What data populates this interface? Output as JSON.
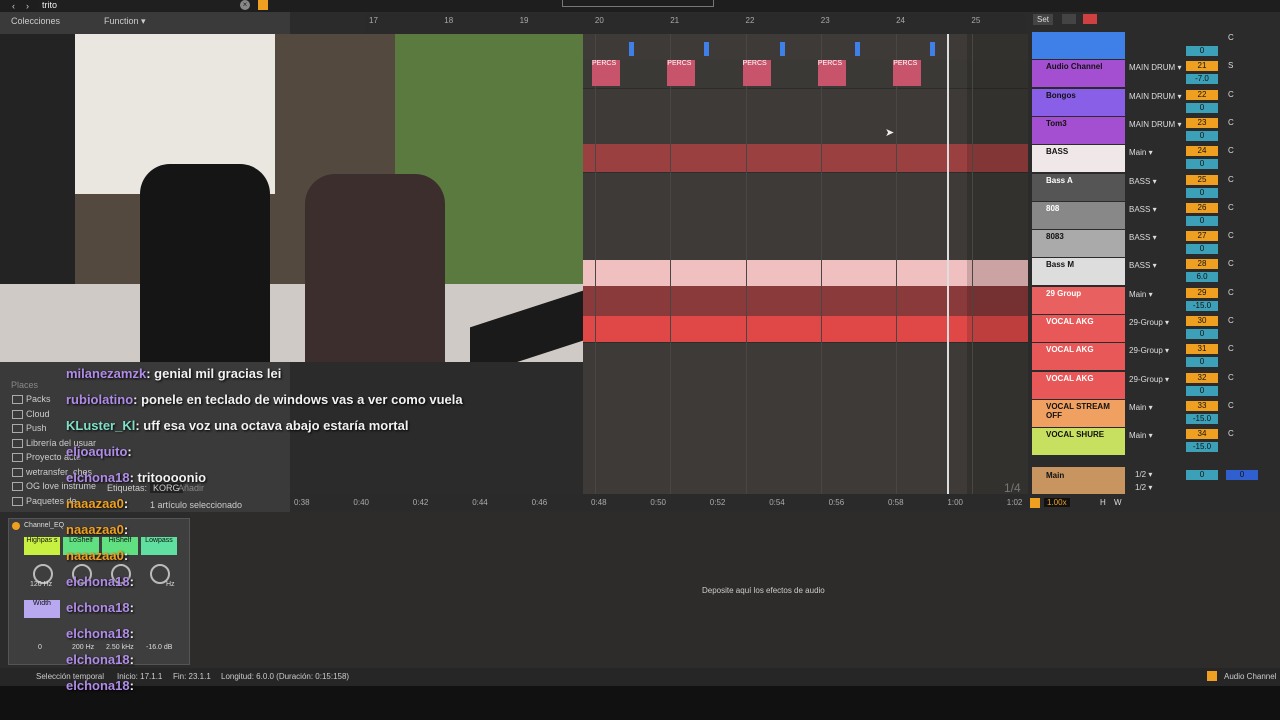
{
  "browser": {
    "search_value": "trito",
    "collections_label": "Colecciones",
    "function_label": "Function ▾",
    "places_label": "Places",
    "places": [
      "Packs",
      "Cloud",
      "Push",
      "Librería del usuar",
      "Proyecto actu",
      "wetransfer_ches",
      "OG love instrume",
      "Paquetes de"
    ],
    "tags_label": "Etiquetas:",
    "tag_value": "KORG",
    "tag_add": "Añadir",
    "selected_info": "1 artículo seleccionado"
  },
  "ruler": {
    "bars": [
      "17",
      "18",
      "19",
      "20",
      "21",
      "22",
      "23",
      "24",
      "25"
    ]
  },
  "set_label": "Set",
  "clips": {
    "percs_label": "PERCS"
  },
  "tracks": [
    {
      "name": "",
      "color": "#3f7fe8",
      "input": "",
      "num": "",
      "vol": "0",
      "C": "C"
    },
    {
      "name": "Audio Channel",
      "color": "#a44fd1",
      "input": "MAIN DRUM ▾",
      "num": "21",
      "vol": "-7.0",
      "C": "S"
    },
    {
      "name": "Bongos",
      "color": "#8a5fe8",
      "input": "MAIN DRUM ▾",
      "num": "22",
      "vol": "0",
      "C": "C"
    },
    {
      "name": "Tom3",
      "color": "#a44fd1",
      "input": "MAIN DRUM ▾",
      "num": "23",
      "vol": "0",
      "C": "C"
    },
    {
      "name": "BASS",
      "color": "#f0e8e8",
      "input": "Main ▾",
      "num": "24",
      "vol": "0",
      "C": "C"
    },
    {
      "name": "Bass A",
      "color": "#555555",
      "input": "BASS ▾",
      "num": "25",
      "vol": "0",
      "C": "C"
    },
    {
      "name": "808",
      "color": "#888888",
      "input": "BASS ▾",
      "num": "26",
      "vol": "0",
      "C": "C"
    },
    {
      "name": "8083",
      "color": "#aaaaaa",
      "input": "BASS ▾",
      "num": "27",
      "vol": "0",
      "C": "C"
    },
    {
      "name": "Bass M",
      "color": "#dddddd",
      "input": "BASS ▾",
      "num": "28",
      "vol": "6.0",
      "C": "C"
    },
    {
      "name": "29 Group",
      "color": "#e86060",
      "input": "Main ▾",
      "num": "29",
      "vol": "-15.0",
      "C": "C"
    },
    {
      "name": "VOCAL AKG",
      "color": "#e85858",
      "input": "29-Group ▾",
      "num": "30",
      "vol": "0",
      "C": "C"
    },
    {
      "name": "VOCAL AKG",
      "color": "#e85858",
      "input": "29-Group ▾",
      "num": "31",
      "vol": "0",
      "C": "C"
    },
    {
      "name": "VOCAL AKG",
      "color": "#e85858",
      "input": "29-Group ▾",
      "num": "32",
      "vol": "0",
      "C": "C"
    },
    {
      "name": "VOCAL STREAM OFF",
      "color": "#f0a060",
      "input": "Main ▾",
      "num": "33",
      "vol": "-15.0",
      "C": "C"
    },
    {
      "name": "VOCAL SHURE",
      "color": "#c8e060",
      "input": "Main ▾",
      "num": "34",
      "vol": "-15.0",
      "C": "C"
    }
  ],
  "main_track": {
    "name": "Main",
    "in1": "1/2 ▾",
    "in2": "1/2 ▾",
    "vol": "0",
    "vol2": "0"
  },
  "fraction": "1/4",
  "time_labels": [
    "0:38",
    "0:40",
    "0:42",
    "0:44",
    "0:46",
    "0:48",
    "0:50",
    "0:52",
    "0:54",
    "0:56",
    "0:58",
    "1:00",
    "1:02"
  ],
  "zoom": "1.00x",
  "hw_labels": [
    "H",
    "W"
  ],
  "chat": [
    {
      "user": "milanezamzk",
      "color": "#b08ce8",
      "msg": ": genial mil gracias lei"
    },
    {
      "user": "rubiolatino",
      "color": "#b08ce8",
      "msg": ": ponele en teclado de windows vas a ver como vuela"
    },
    {
      "user": "KLuster_Kl",
      "color": "#7fe0c8",
      "msg": ": uff esa voz una octava abajo estaría mortal"
    },
    {
      "user": "eljoaquito",
      "color": "#b08ce8",
      "msg": ":"
    },
    {
      "user": "elchona18",
      "color": "#b08ce8",
      "msg": ": tritoooonio"
    },
    {
      "user": "naaazaa0",
      "color": "#f0a020",
      "msg": ":"
    },
    {
      "user": "naaazaa0",
      "color": "#f0a020",
      "msg": ":"
    },
    {
      "user": "naaazaa0",
      "color": "#f0a020",
      "msg": ":"
    },
    {
      "user": "elchona18",
      "color": "#b08ce8",
      "msg": ":"
    },
    {
      "user": "elchona18",
      "color": "#b08ce8",
      "msg": ":"
    },
    {
      "user": "elchona18",
      "color": "#b08ce8",
      "msg": ":"
    },
    {
      "user": "elchona18",
      "color": "#b08ce8",
      "msg": ":"
    },
    {
      "user": "elchona18",
      "color": "#b08ce8",
      "msg": ":"
    }
  ],
  "device": {
    "title": "Channel_EQ",
    "buttons": [
      "Highpas s",
      "LoShelf",
      "HiShelf",
      "Lowpass"
    ],
    "row2": [
      "Width"
    ],
    "values": [
      "120 Hz",
      "Hz",
      "0",
      "200 Hz",
      "2.50 kHz",
      "-16.0 dB"
    ]
  },
  "drop_hint": "Deposite aquí los efectos de audio",
  "status": {
    "selection": "Selección temporal",
    "start": "Inicio: 17.1.1",
    "end": "Fin: 23.1.1",
    "length": "Longitud: 6.0.0 (Duración: 0:15:158)",
    "right": "Audio Channel"
  }
}
